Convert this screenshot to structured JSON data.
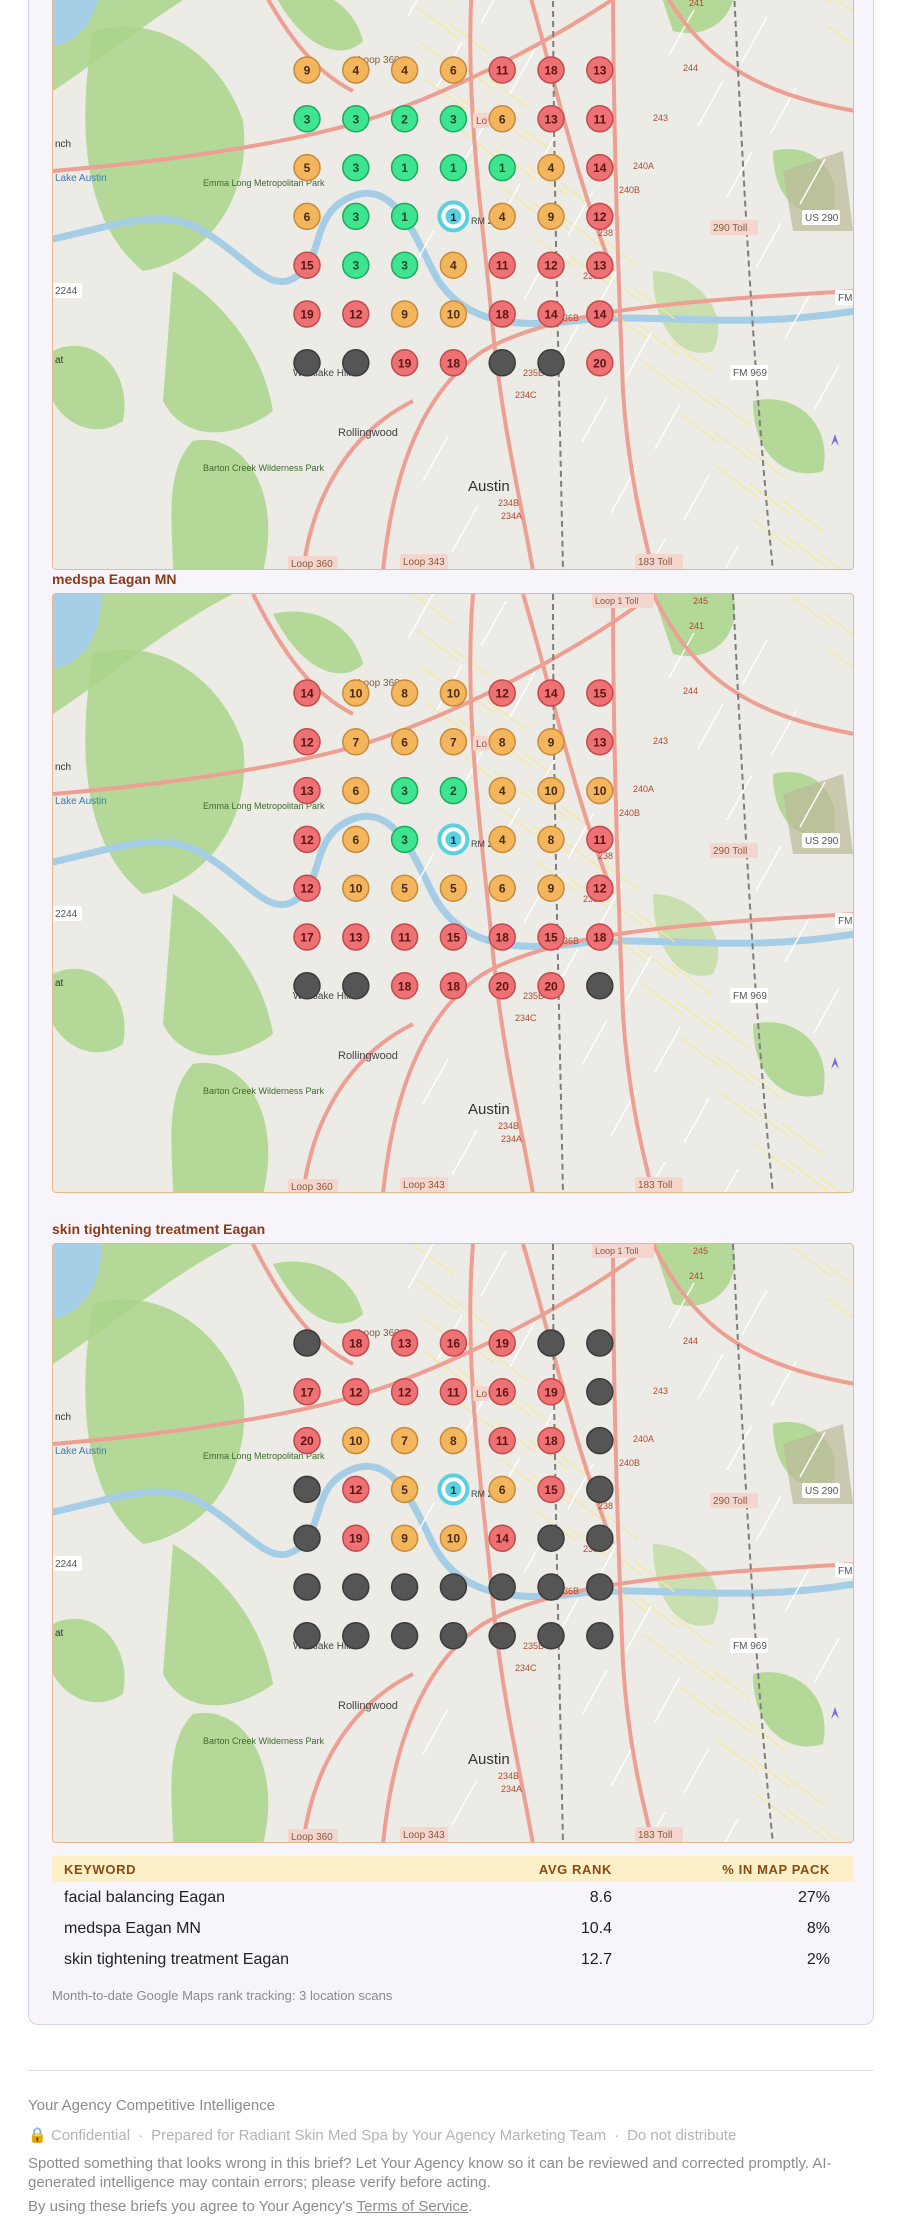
{
  "maps": [
    {
      "id": "facial-balancing",
      "title": "",
      "grid": [
        [
          "9",
          "4",
          "4",
          "6",
          "11",
          "18",
          "13"
        ],
        [
          "3",
          "3",
          "2",
          "3",
          "6",
          "13",
          "11"
        ],
        [
          "5",
          "3",
          "1",
          "1",
          "1",
          "4",
          "14"
        ],
        [
          "6",
          "3",
          "1",
          "1",
          "4",
          "9",
          "12"
        ],
        [
          "15",
          "3",
          "3",
          "4",
          "11",
          "12",
          "13"
        ],
        [
          "19",
          "12",
          "9",
          "10",
          "18",
          "14",
          "14"
        ],
        [
          "",
          "",
          "19",
          "18",
          "",
          "",
          "20"
        ]
      ]
    },
    {
      "id": "medspa",
      "title": "medspa Eagan MN",
      "grid": [
        [
          "14",
          "10",
          "8",
          "10",
          "12",
          "14",
          "15"
        ],
        [
          "12",
          "7",
          "6",
          "7",
          "8",
          "9",
          "13"
        ],
        [
          "13",
          "6",
          "3",
          "2",
          "4",
          "10",
          "10"
        ],
        [
          "12",
          "6",
          "3",
          "1",
          "4",
          "8",
          "11"
        ],
        [
          "12",
          "10",
          "5",
          "5",
          "6",
          "9",
          "12"
        ],
        [
          "17",
          "13",
          "11",
          "15",
          "18",
          "15",
          "18"
        ],
        [
          "",
          "",
          "18",
          "18",
          "20",
          "20",
          ""
        ]
      ]
    },
    {
      "id": "skin-tightening",
      "title": "skin tightening treatment Eagan",
      "grid": [
        [
          "",
          "18",
          "13",
          "16",
          "19",
          "",
          ""
        ],
        [
          "17",
          "12",
          "12",
          "11",
          "16",
          "19",
          ""
        ],
        [
          "20",
          "10",
          "7",
          "8",
          "11",
          "18",
          ""
        ],
        [
          "",
          "12",
          "5",
          "1",
          "6",
          "15",
          ""
        ],
        [
          "",
          "19",
          "9",
          "10",
          "14",
          "",
          ""
        ],
        [
          "",
          "",
          "",
          "",
          "",
          "",
          ""
        ],
        [
          "",
          "",
          "",
          "",
          "",
          "",
          ""
        ]
      ]
    }
  ],
  "map_labels": {
    "austin": "Austin",
    "rollingwood": "Rollingwood",
    "westlake_hills": "Westlake Hills",
    "loop360_top": "Loop 360",
    "loop360_bottom": "Loop 360",
    "loop343": "Loop 343",
    "toll183": "183 Toll",
    "toll290": "290 Toll",
    "us290": "US 290",
    "fm969": "FM 969",
    "r2244": "2244",
    "lake_austin": "Lake Austin",
    "emma_long": "Emma Long Metropolitan Park",
    "barton_creek": "Barton Creek Wilderness Park",
    "rm": "RM 2",
    "r243": "243",
    "r244": "244",
    "r241": "241",
    "r245": "245",
    "r240a": "240A",
    "r240b": "240B",
    "r238": "238",
    "r238b": "238B",
    "r236b": "236B",
    "r235b": "235B",
    "r234c": "234C",
    "r234b": "234B",
    "r234a": "234A",
    "fm": "FM",
    "lo": "Lo",
    "nch": "nch",
    "at": "at",
    "lake_top": "Loop 1 Toll"
  },
  "table": {
    "headers": [
      "KEYWORD",
      "AVG RANK",
      "% IN MAP PACK"
    ],
    "rows": [
      {
        "keyword": "facial balancing Eagan",
        "avg_rank": "8.6",
        "pct": "27%"
      },
      {
        "keyword": "medspa Eagan MN",
        "avg_rank": "10.4",
        "pct": "8%"
      },
      {
        "keyword": "skin tightening treatment Eagan",
        "avg_rank": "12.7",
        "pct": "2%"
      }
    ],
    "note": "Month-to-date Google Maps rank tracking: 3 location scans"
  },
  "footer": {
    "brand": "Your Agency Competitive Intelligence",
    "lock_icon": "lock-icon",
    "confidential": "Confidential",
    "prepared": "Prepared for Radiant Skin Med Spa by Your Agency Marketing Team",
    "distribution": "Do not distribute",
    "separator": "·",
    "warning": "Spotted something that looks wrong in this brief? Let Your Agency know so it can be reviewed and corrected promptly. AI-generated intelligence may contain errors; please verify before acting.",
    "terms_prefix": "By using these briefs you agree to Your Agency's ",
    "terms_link": "Terms of Service",
    "terms_suffix": "."
  },
  "colors": {
    "top3": "#3de58f",
    "mid": "#f3b65c",
    "low": "#ee7174",
    "none": "#555555",
    "center": "#5ccfe0"
  }
}
